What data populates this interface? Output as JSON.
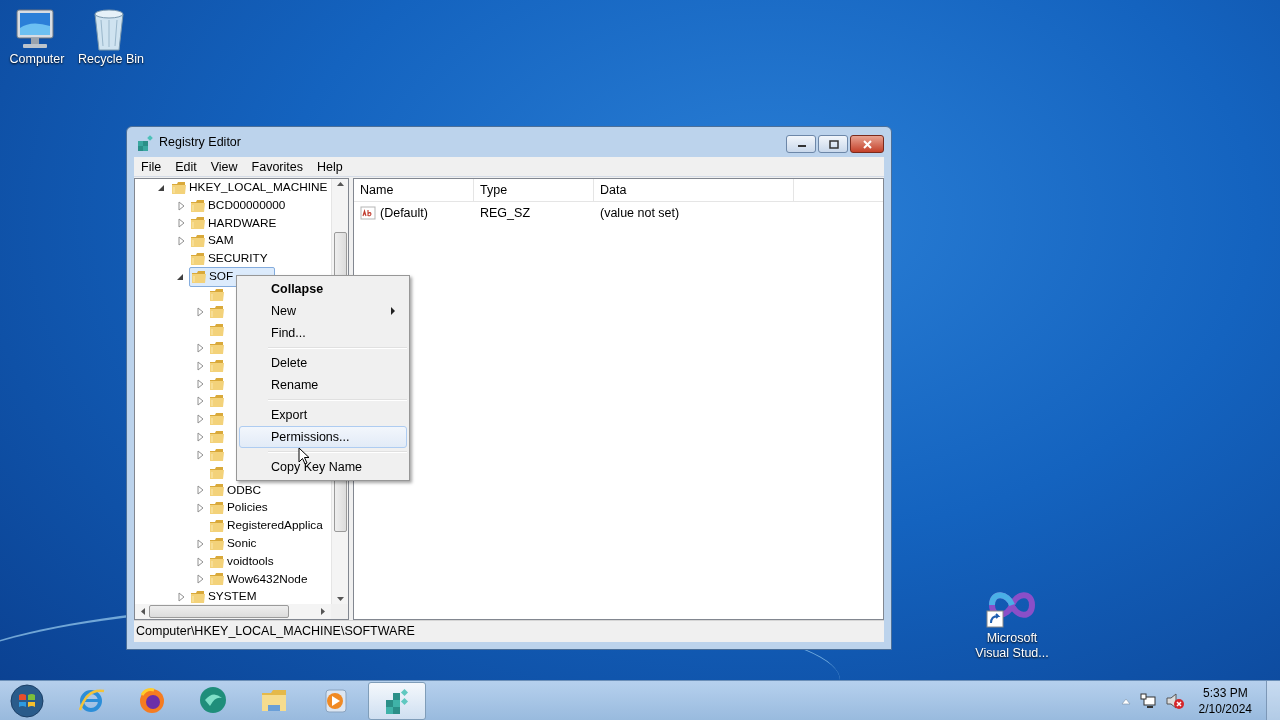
{
  "desktop_icons": [
    {
      "kind": "computer",
      "label": "Computer",
      "shortcut": false
    },
    {
      "kind": "recycle-bin",
      "label": "Recycle Bin",
      "shortcut": false
    },
    {
      "kind": "infinity",
      "label": "Microsoft Visual Stud...",
      "shortcut": true
    }
  ],
  "window": {
    "title": "Registry Editor",
    "menu": [
      "File",
      "Edit",
      "View",
      "Favorites",
      "Help"
    ],
    "tree": [
      {
        "label": "HKEY_LOCAL_MACHINE",
        "expandable": true,
        "expanded": true,
        "selected": false,
        "children": [
          {
            "label": "BCD00000000",
            "expandable": true,
            "expanded": false,
            "selected": false
          },
          {
            "label": "HARDWARE",
            "expandable": true,
            "expanded": false,
            "selected": false
          },
          {
            "label": "SAM",
            "expandable": true,
            "expanded": false,
            "selected": false
          },
          {
            "label": "SECURITY",
            "expandable": false,
            "expanded": false,
            "selected": false
          },
          {
            "label": "SOF",
            "expandable": true,
            "expanded": true,
            "selected": true,
            "children": [
              {
                "expandable": false,
                "expanded": false,
                "selected": false
              },
              {
                "expandable": true,
                "expanded": false,
                "selected": false
              },
              {
                "expandable": false,
                "expanded": false,
                "selected": false
              },
              {
                "expandable": true,
                "expanded": false,
                "selected": false
              },
              {
                "expandable": true,
                "expanded": false,
                "selected": false
              },
              {
                "expandable": true,
                "expanded": false,
                "selected": false
              },
              {
                "expandable": true,
                "expanded": false,
                "selected": false
              },
              {
                "expandable": true,
                "expanded": false,
                "selected": false
              },
              {
                "expandable": true,
                "expanded": false,
                "selected": false
              },
              {
                "expandable": true,
                "expanded": false,
                "selected": false
              },
              {
                "expandable": false,
                "expanded": false,
                "selected": false
              },
              {
                "label": "ODBC",
                "expandable": true,
                "expanded": false,
                "selected": false
              },
              {
                "label": "Policies",
                "expandable": true,
                "expanded": false,
                "selected": false
              },
              {
                "label": "RegisteredApplica",
                "expandable": false,
                "expanded": false,
                "selected": false
              },
              {
                "label": "Sonic",
                "expandable": true,
                "expanded": false,
                "selected": false
              },
              {
                "label": "voidtools",
                "expandable": true,
                "expanded": false,
                "selected": false
              },
              {
                "label": "Wow6432Node",
                "expandable": true,
                "expanded": false,
                "selected": false
              }
            ]
          },
          {
            "label": "SYSTEM",
            "expandable": true,
            "expanded": false,
            "selected": false
          }
        ]
      }
    ],
    "list": {
      "columns": [
        "Name",
        "Type",
        "Data"
      ],
      "rows": [
        {
          "name": "(Default)",
          "type": "REG_SZ",
          "data": "(value not set)"
        }
      ]
    },
    "status_bar": "Computer\\HKEY_LOCAL_MACHINE\\SOFTWARE"
  },
  "context_menu": {
    "items": [
      {
        "kind": "item",
        "label": "Collapse",
        "default": true,
        "submenu": false,
        "highlighted": false
      },
      {
        "kind": "item",
        "label": "New",
        "default": false,
        "submenu": true,
        "highlighted": false
      },
      {
        "kind": "item",
        "label": "Find...",
        "default": false,
        "submenu": false,
        "highlighted": false
      },
      {
        "kind": "separator"
      },
      {
        "kind": "item",
        "label": "Delete",
        "default": false,
        "submenu": false,
        "highlighted": false
      },
      {
        "kind": "item",
        "label": "Rename",
        "default": false,
        "submenu": false,
        "highlighted": false
      },
      {
        "kind": "separator"
      },
      {
        "kind": "item",
        "label": "Export",
        "default": false,
        "submenu": false,
        "highlighted": false
      },
      {
        "kind": "item",
        "label": "Permissions...",
        "default": false,
        "submenu": false,
        "highlighted": true
      },
      {
        "kind": "separator"
      },
      {
        "kind": "item",
        "label": "Copy Key Name",
        "default": false,
        "submenu": false,
        "highlighted": false
      }
    ]
  },
  "taskbar": {
    "apps": [
      {
        "kind": "ie",
        "active": false
      },
      {
        "kind": "firefox",
        "active": false
      },
      {
        "kind": "green-app",
        "active": false
      },
      {
        "kind": "folder",
        "active": false
      },
      {
        "kind": "media",
        "active": false
      },
      {
        "kind": "regedit",
        "active": true
      }
    ],
    "tray": {
      "volume_muted": true,
      "time": "5:33 PM",
      "date": "2/10/2024"
    }
  }
}
